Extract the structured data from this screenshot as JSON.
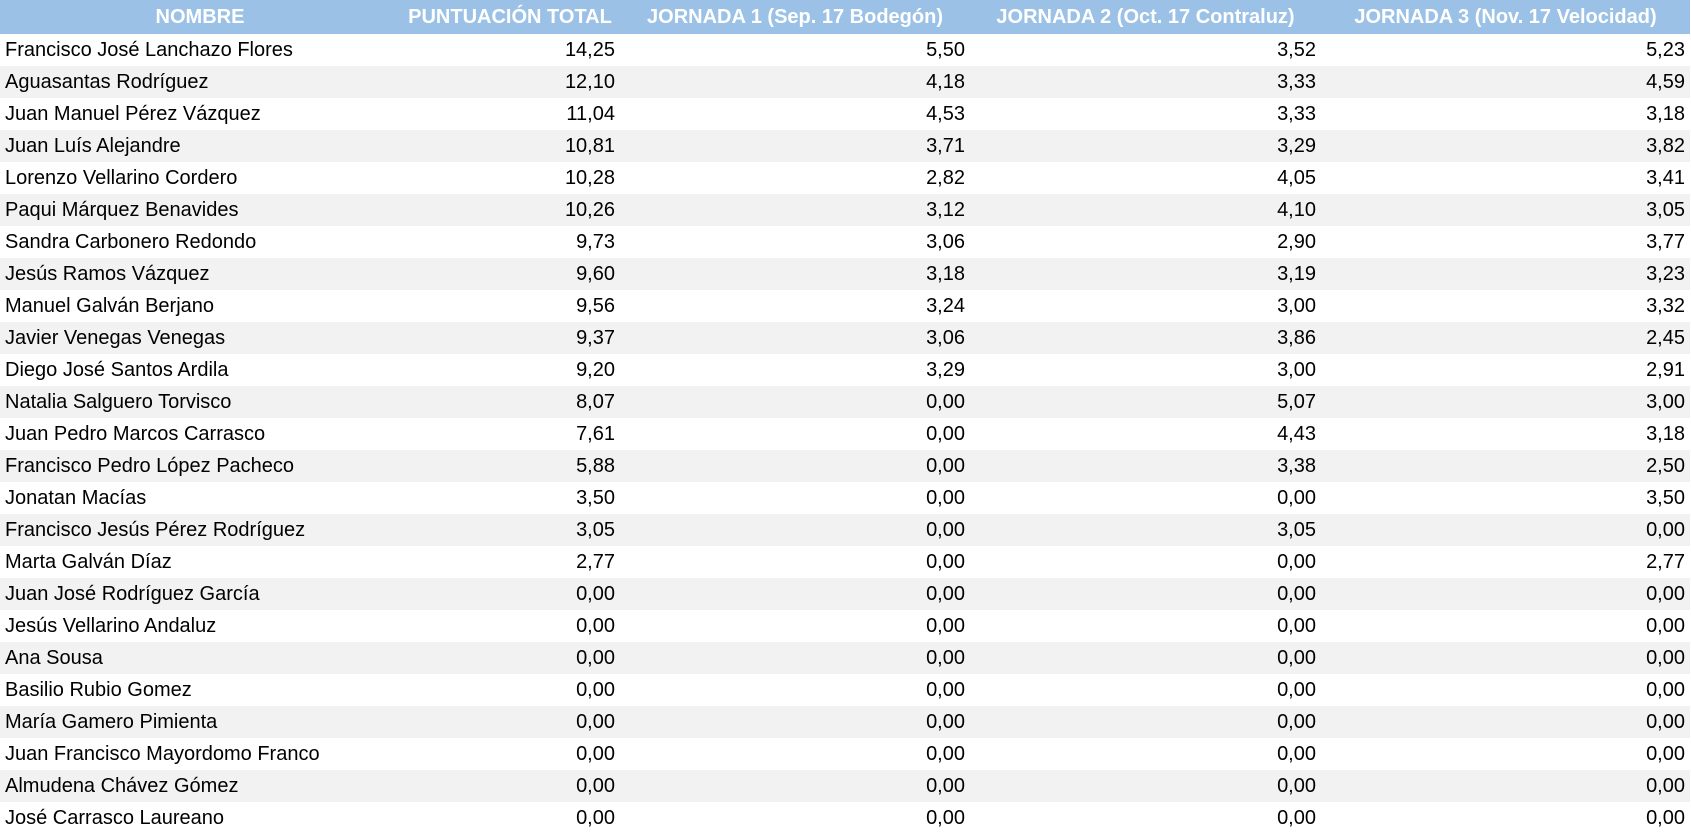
{
  "headers": [
    "NOMBRE",
    "PUNTUACIÓN TOTAL",
    "JORNADA 1 (Sep. 17 Bodegón)",
    "JORNADA 2 (Oct. 17 Contraluz)",
    "JORNADA 3 (Nov. 17 Velocidad)"
  ],
  "colors": {
    "header_bg": "#9bc2e6",
    "header_text": "#ffffff",
    "band_row": "#f2f2f2"
  },
  "rows": [
    [
      "Francisco José Lanchazo Flores",
      "14,25",
      "5,50",
      "3,52",
      "5,23"
    ],
    [
      "Aguasantas Rodríguez",
      "12,10",
      "4,18",
      "3,33",
      "4,59"
    ],
    [
      "Juan Manuel Pérez Vázquez",
      "11,04",
      "4,53",
      "3,33",
      "3,18"
    ],
    [
      "Juan Luís Alejandre",
      "10,81",
      "3,71",
      "3,29",
      "3,82"
    ],
    [
      "Lorenzo Vellarino Cordero",
      "10,28",
      "2,82",
      "4,05",
      "3,41"
    ],
    [
      "Paqui Márquez Benavides",
      "10,26",
      "3,12",
      "4,10",
      "3,05"
    ],
    [
      "Sandra Carbonero Redondo",
      "9,73",
      "3,06",
      "2,90",
      "3,77"
    ],
    [
      "Jesús Ramos Vázquez",
      "9,60",
      "3,18",
      "3,19",
      "3,23"
    ],
    [
      "Manuel Galván Berjano",
      "9,56",
      "3,24",
      "3,00",
      "3,32"
    ],
    [
      "Javier Venegas Venegas",
      "9,37",
      "3,06",
      "3,86",
      "2,45"
    ],
    [
      "Diego José Santos Ardila",
      "9,20",
      "3,29",
      "3,00",
      "2,91"
    ],
    [
      "Natalia Salguero Torvisco",
      "8,07",
      "0,00",
      "5,07",
      "3,00"
    ],
    [
      "Juan Pedro Marcos Carrasco",
      "7,61",
      "0,00",
      "4,43",
      "3,18"
    ],
    [
      "Francisco Pedro López Pacheco",
      "5,88",
      "0,00",
      "3,38",
      "2,50"
    ],
    [
      "Jonatan Macías",
      "3,50",
      "0,00",
      "0,00",
      "3,50"
    ],
    [
      "Francisco Jesús Pérez Rodríguez",
      "3,05",
      "0,00",
      "3,05",
      "0,00"
    ],
    [
      "Marta Galván Díaz",
      "2,77",
      "0,00",
      "0,00",
      "2,77"
    ],
    [
      "Juan José Rodríguez García",
      "0,00",
      "0,00",
      "0,00",
      "0,00"
    ],
    [
      "Jesús Vellarino Andaluz",
      "0,00",
      "0,00",
      "0,00",
      "0,00"
    ],
    [
      "Ana Sousa",
      "0,00",
      "0,00",
      "0,00",
      "0,00"
    ],
    [
      "Basilio Rubio Gomez",
      "0,00",
      "0,00",
      "0,00",
      "0,00"
    ],
    [
      "María Gamero Pimienta",
      "0,00",
      "0,00",
      "0,00",
      "0,00"
    ],
    [
      "Juan Francisco Mayordomo Franco",
      "0,00",
      "0,00",
      "0,00",
      "0,00"
    ],
    [
      "Almudena Chávez Gómez",
      "0,00",
      "0,00",
      "0,00",
      "0,00"
    ],
    [
      "José Carrasco Laureano",
      "0,00",
      "0,00",
      "0,00",
      "0,00"
    ]
  ]
}
